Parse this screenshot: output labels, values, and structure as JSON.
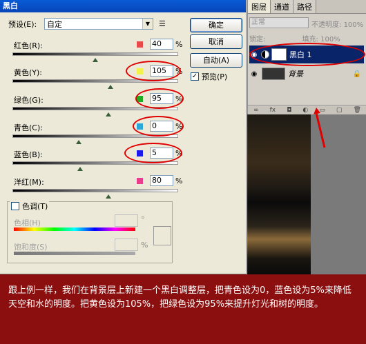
{
  "dialog": {
    "title": "黑白",
    "preset_label": "预设(E):",
    "preset_value": "自定",
    "buttons": {
      "ok": "确定",
      "cancel": "取消",
      "auto": "自动(A)"
    },
    "preview_label": "预览(P)",
    "preview_checked": true
  },
  "sliders": [
    {
      "label": "红色(R):",
      "value": "40",
      "unit": "%",
      "color": "#e84a4a",
      "fraction": 0.5
    },
    {
      "label": "黄色(Y):",
      "value": "105",
      "unit": "%",
      "color": "#f2f24a",
      "fraction": 0.59
    },
    {
      "label": "绿色(G):",
      "value": "95",
      "unit": "%",
      "color": "#22aa22",
      "fraction": 0.58
    },
    {
      "label": "青色(C):",
      "value": "0",
      "unit": "%",
      "color": "#2aa8d8",
      "fraction": 0.4
    },
    {
      "label": "蓝色(B):",
      "value": "5",
      "unit": "%",
      "color": "#1a1aee",
      "fraction": 0.41
    },
    {
      "label": "洋红(M):",
      "value": "80",
      "unit": "%",
      "color": "#e83c8c",
      "fraction": 0.58
    }
  ],
  "tone": {
    "label": "色调(T)",
    "hue_label": "色相(H)",
    "hue_unit": "°",
    "saturation_label": "饱和度(S)",
    "saturation_unit": "%"
  },
  "layers_panel": {
    "tabs": [
      "图层",
      "通道",
      "路径"
    ],
    "blend_mode": "正常",
    "opacity_label": "不透明度:",
    "opacity_value": "100%",
    "lock_label": "锁定:",
    "fill_label": "填充:",
    "fill_value": "100%",
    "layers": [
      {
        "name": "黑白 1",
        "selected": true
      },
      {
        "name": "背景",
        "selected": false
      }
    ]
  },
  "caption": "跟上例一样，我们在背景层上新建一个黑白调整层，把青色设为0，蓝色设为5%来降低天空和水的明度。把黄色设为105%，把绿色设为95%来提升灯光和树的明度。",
  "colors": {
    "highlight_ring": "#e00000",
    "caption_bg": "#8b0f0f",
    "title_bar": "#0a5bd6"
  }
}
